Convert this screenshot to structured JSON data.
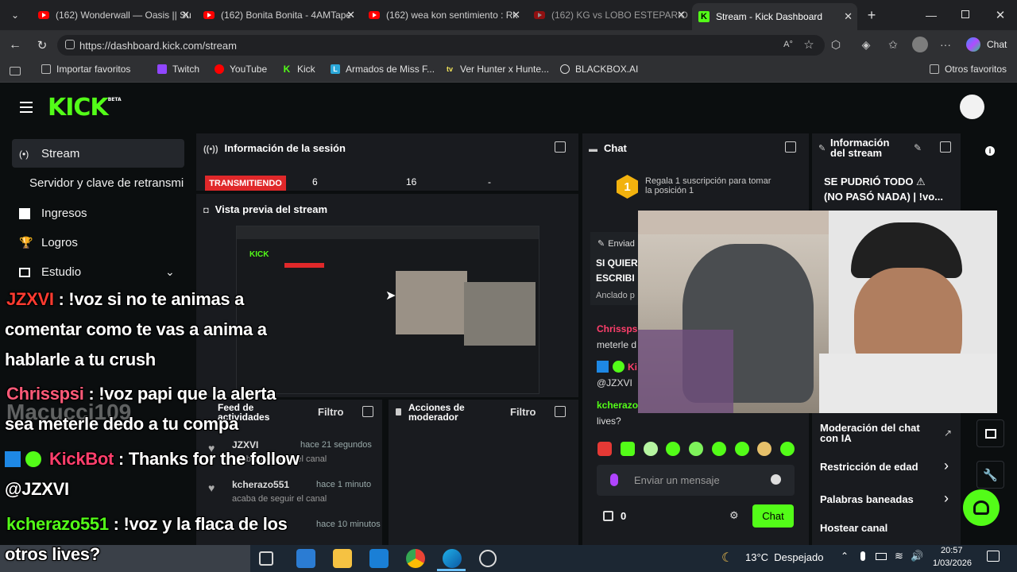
{
  "browser": {
    "tabs": [
      {
        "title": "(162) Wonderwall — Oasis || Su"
      },
      {
        "title": "(162) Bonita Bonita - 4AMTape"
      },
      {
        "title": "(162) wea kon sentimiento : Rk"
      },
      {
        "title": "(162) KG vs LOBO ESTEPARIO | K"
      },
      {
        "title": "Stream - Kick Dashboard"
      }
    ],
    "url": "https://dashboard.kick.com/stream",
    "chat_label": "Chat",
    "bookmarks": [
      {
        "label": "Importar favoritos"
      },
      {
        "label": "Twitch"
      },
      {
        "label": "YouTube"
      },
      {
        "label": "Kick"
      },
      {
        "label": "Armados de Miss F..."
      },
      {
        "label": "Ver Hunter x Hunte..."
      },
      {
        "label": "BLACKBOX.AI"
      }
    ],
    "other_bookmarks": "Otros favoritos"
  },
  "kick": {
    "logo": "KICK",
    "logo_badge": "BETA",
    "sidebar": [
      {
        "label": "Stream"
      },
      {
        "label": "Servidor y clave de retransmi"
      },
      {
        "label": "Ingresos"
      },
      {
        "label": "Logros"
      },
      {
        "label": "Estudio"
      }
    ],
    "session": {
      "title": "Información de la sesión",
      "status": "TRANSMITIENDO",
      "stat1": "6",
      "stat2": "16",
      "stat3": "-"
    },
    "preview": {
      "title": "Vista previa del stream"
    },
    "activity": {
      "title": "Feed de actividades",
      "filter": "Filtro",
      "items": [
        {
          "user": "JZXVI",
          "time": "hace 21 segundos",
          "action": "acaba de seguir el canal"
        },
        {
          "user": "kcherazo551",
          "time": "hace 1 minuto",
          "action": "acaba de seguir el canal"
        },
        {
          "user": "",
          "time": "hace 10 minutos",
          "action": ""
        }
      ]
    },
    "modactions": {
      "title": "Acciones de moderador",
      "filter": "Filtro"
    },
    "chat": {
      "title": "Chat",
      "gift_rank": "1",
      "gift_text": "Regala 1 suscripción para tomar la posición 1",
      "pinned_label": "Enviad",
      "pinned_text1": "SI QUIER",
      "pinned_text2": "ESCRIBI",
      "pinned_by": "Anclado p",
      "msgs": [
        {
          "user": "Chrissps",
          "text": "meterle d"
        },
        {
          "user": "Ki",
          "text": "@JZXVI"
        },
        {
          "user": "kcherazo",
          "text": "lives?"
        }
      ],
      "input_placeholder": "Enviar un mensaje",
      "points": "0",
      "send_label": "Chat"
    },
    "streaminfo": {
      "title": "Información del stream",
      "stream_title_line1": "SE PUDRIÓ TODO ⚠",
      "stream_title_line2": "(NO PASÓ NADA) | !vo...",
      "menu": [
        {
          "label": "Moderación del chat con IA"
        },
        {
          "label": "Restricción de edad"
        },
        {
          "label": "Palabras baneadas"
        },
        {
          "label": "Hostear canal"
        }
      ]
    }
  },
  "overlay": {
    "watermark": "Macucci109",
    "messages": [
      {
        "user": "JZXVI",
        "sep": " : ",
        "line1": "!voz si no te animas a",
        "line2": "comentar como te vas a anima a",
        "line3": "hablarle a tu crush"
      },
      {
        "user": "Chrisspsi",
        "sep": " : ",
        "line1": "!voz papi que la alerta",
        "line2": "sea meterle dedo a tu compa"
      },
      {
        "user": "KickBot",
        "sep": " : ",
        "line1": "Thanks for the follow",
        "line2": "@JZXVI"
      },
      {
        "user": "kcherazo551",
        "sep": " : ",
        "line1": "!voz y la flaca de los",
        "line2": "otros lives?"
      }
    ]
  },
  "taskbar": {
    "weather": "13°C  Despejado",
    "time": "20:57",
    "date": "1/03/2026"
  },
  "colors": {
    "kick_green": "#53fc18",
    "live_red": "#e0282a",
    "panel": "#191b1f"
  }
}
